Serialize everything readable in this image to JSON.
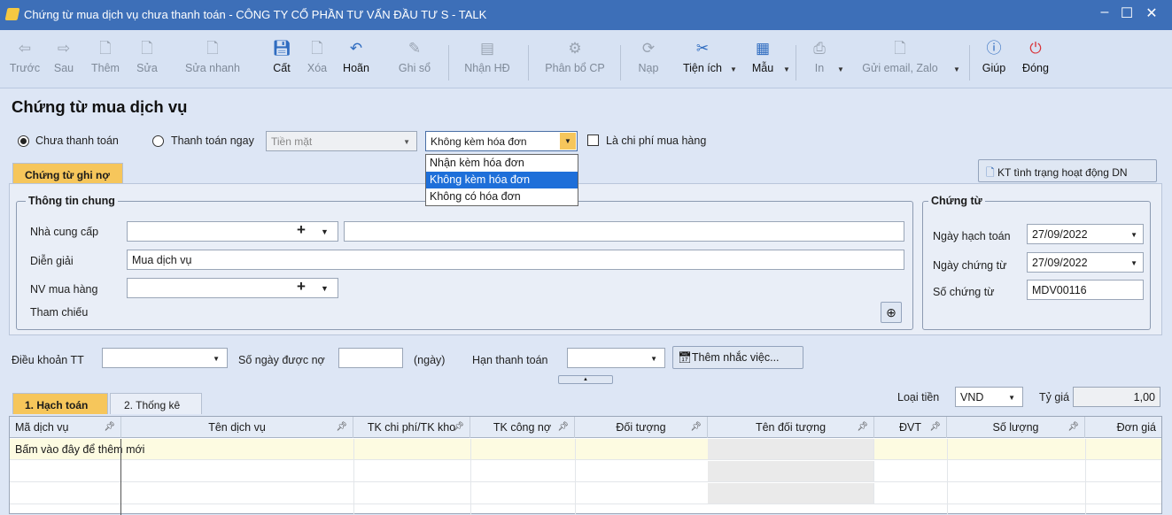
{
  "window": {
    "title": "Chứng từ mua dịch vụ chưa thanh toán - CÔNG TY CỔ PHẦN TƯ VẤN ĐẦU TƯ S - TALK"
  },
  "toolbar": {
    "truoc": "Trước",
    "sau": "Sau",
    "them": "Thêm",
    "sua": "Sửa",
    "sua_nhanh": "Sửa nhanh",
    "cat": "Cất",
    "xoa": "Xóa",
    "hoan": "Hoãn",
    "ghi_so": "Ghi sổ",
    "nhan_hd": "Nhận HĐ",
    "phan_bo_cp": "Phân bổ CP",
    "nap": "Nạp",
    "tien_ich": "Tiện ích",
    "mau": "Mẫu",
    "in": "In",
    "gui_email": "Gửi email, Zalo",
    "giup": "Giúp",
    "dong": "Đóng"
  },
  "page": {
    "title": "Chứng từ mua dịch vụ"
  },
  "payment": {
    "unpaid_label": "Chưa thanh toán",
    "paid_label": "Thanh toán ngay",
    "method_value": "Tiền mặt",
    "invoice_value": "Không kèm hóa đơn",
    "expense_label": "Là chi phí mua hàng"
  },
  "invoice_options": [
    "Nhận kèm hóa đơn",
    "Không kèm hóa đơn",
    "Không có hóa đơn"
  ],
  "tabs": {
    "voucher": "Chứng từ ghi nợ",
    "check_btn": "KT tình trạng hoạt động DN"
  },
  "general": {
    "title": "Thông tin chung",
    "supplier_label": "Nhà cung cấp",
    "desc_label": "Diễn giải",
    "desc_value": "Mua dịch vụ",
    "buyer_label": "NV mua hàng",
    "ref_label": "Tham chiếu"
  },
  "voucher": {
    "title": "Chứng từ",
    "post_date_label": "Ngày hạch toán",
    "post_date": "27/09/2022",
    "voucher_date_label": "Ngày chứng từ",
    "voucher_date": "27/09/2022",
    "number_label": "Số chứng từ",
    "number": "MDV00116"
  },
  "terms": {
    "term_label": "Điều khoản TT",
    "days_label": "Số ngày được nợ",
    "days_unit": "(ngày)",
    "due_label": "Hạn thanh toán",
    "reminder_btn": "Thêm nhắc việc..."
  },
  "detail": {
    "tab1": "1. Hạch toán",
    "tab2": "2. Thống kê",
    "currency_label": "Loại tiền",
    "currency": "VND",
    "rate_label": "Tỷ giá",
    "rate": "1,00"
  },
  "grid": {
    "columns": [
      "Mã dịch vụ",
      "Tên dịch vụ",
      "TK chi phí/TK kho",
      "TK công nợ",
      "Đối tượng",
      "Tên đối tượng",
      "ĐVT",
      "Số lượng",
      "Đơn giá"
    ],
    "add_new": "Bấm vào đây để thêm mới"
  },
  "colors": {
    "titlebar": "#3d6fb8",
    "tab_active": "#f6c65b",
    "selection": "#1e6fd9",
    "new_row": "#fdfbe1"
  }
}
